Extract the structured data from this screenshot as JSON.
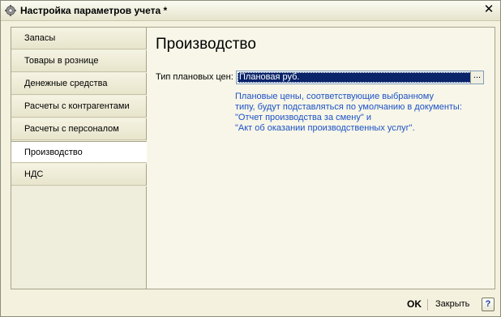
{
  "window": {
    "title": "Настройка параметров учета *",
    "close_glyph": "✕"
  },
  "tabs": [
    {
      "label": "Запасы"
    },
    {
      "label": "Товары в рознице"
    },
    {
      "label": "Денежные средства"
    },
    {
      "label": "Расчеты с контрагентами"
    },
    {
      "label": "Расчеты с персоналом"
    },
    {
      "label": "Производство",
      "active": true
    },
    {
      "label": "НДС"
    }
  ],
  "content": {
    "title": "Производство",
    "price_type": {
      "label": "Тип плановых цен:",
      "value": "Плановая руб.",
      "button_glyph": "..."
    },
    "hint_lines": [
      "Плановые цены, соответствующие выбранному",
      "типу, будут подставляться по умолчанию в документы:",
      "\"Отчет производства за смену\" и",
      "\"Акт об оказании производственных услуг\"."
    ]
  },
  "footer": {
    "ok_label": "OK",
    "close_label": "Закрыть",
    "help_glyph": "?"
  },
  "colors": {
    "hint_text": "#1d52c8",
    "selection": "#0a246a",
    "window_bg": "#f4f2de"
  }
}
